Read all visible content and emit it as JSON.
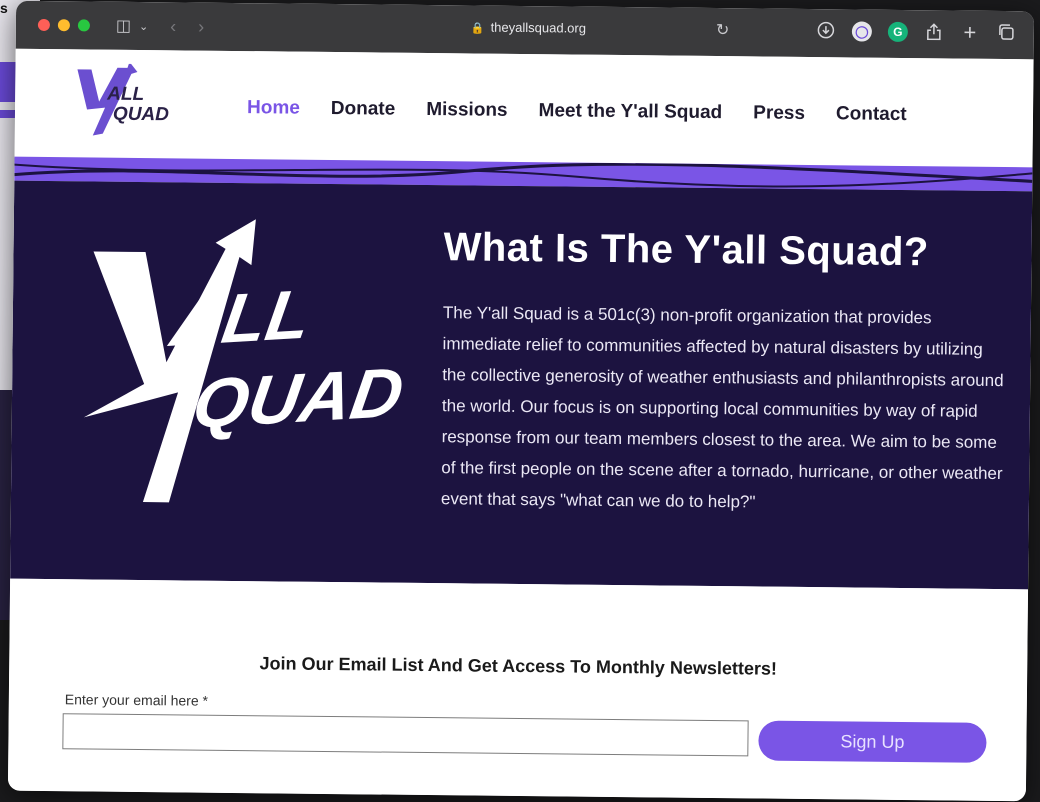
{
  "browser": {
    "url": "theyallsquad.org",
    "icons": {
      "sidebar": "sidebar-icon",
      "back": "chevron-left-icon",
      "forward": "chevron-right-icon",
      "reload": "reload-icon",
      "download": "download-icon",
      "password": "password-manager-icon",
      "grammarly": "grammarly-icon",
      "share": "share-icon",
      "new_tab": "plus-icon",
      "tabs": "tabs-overview-icon"
    }
  },
  "site": {
    "logo_text": {
      "line1": "ALL",
      "line2": "QUAD"
    },
    "nav": [
      {
        "label": "Home",
        "active": true
      },
      {
        "label": "Donate"
      },
      {
        "label": "Missions"
      },
      {
        "label": "Meet the Y'all Squad"
      },
      {
        "label": "Press"
      },
      {
        "label": "Contact"
      }
    ]
  },
  "hero": {
    "title": "What Is The Y'all Squad?",
    "body": "The Y'all Squad is a 501c(3) non-profit organization that provides immediate relief to communities affected by natural disasters by utilizing the collective generosity of weather enthusiasts and philanthropists around the world. Our focus is on supporting local communities by way of rapid response from our team members closest to the area. We aim to be some of the first people on the scene after a tornado, hurricane, or other weather event that says \"what can we do to help?\""
  },
  "newsletter": {
    "title": "Join Our Email List And Get Access To Monthly Newsletters!",
    "email_label": "Enter your email here *",
    "email_value": "",
    "signup_label": "Sign Up"
  },
  "colors": {
    "accent": "#7a55e6",
    "hero_bg": "#1c1340",
    "titlebar": "#3a3a3c"
  }
}
